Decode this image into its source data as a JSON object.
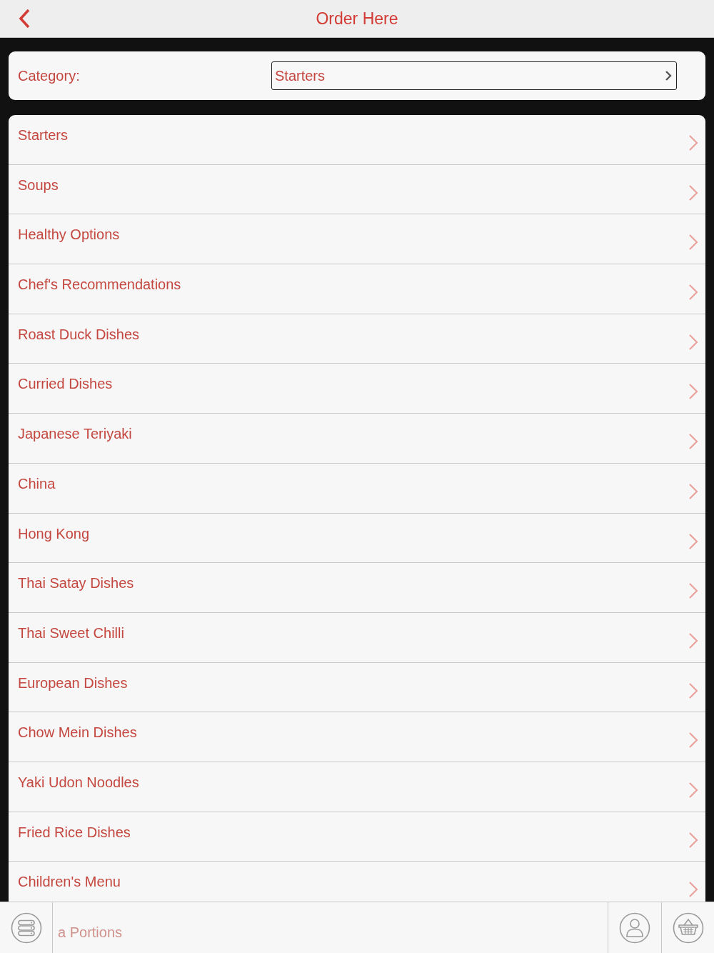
{
  "header": {
    "title": "Order Here"
  },
  "category_picker": {
    "label": "Category:",
    "value": "Starters"
  },
  "categories": [
    {
      "label": "Starters"
    },
    {
      "label": "Soups"
    },
    {
      "label": "Healthy Options"
    },
    {
      "label": "Chef's Recommendations"
    },
    {
      "label": "Roast Duck Dishes"
    },
    {
      "label": "Curried Dishes"
    },
    {
      "label": "Japanese Teriyaki"
    },
    {
      "label": "China"
    },
    {
      "label": "Hong Kong"
    },
    {
      "label": "Thai Satay Dishes"
    },
    {
      "label": "Thai Sweet Chilli"
    },
    {
      "label": "European Dishes"
    },
    {
      "label": "Chow Mein Dishes"
    },
    {
      "label": "Yaki Udon Noodles"
    },
    {
      "label": "Fried Rice Dishes"
    },
    {
      "label": "Children's Menu"
    }
  ],
  "partially_hidden_item": {
    "label": "a Portions"
  }
}
